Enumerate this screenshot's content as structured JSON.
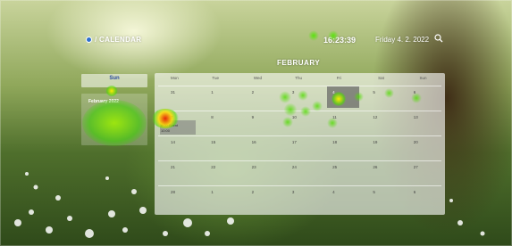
{
  "header": {
    "app_title": "/ CALENDAR",
    "time": "16:23:39",
    "date": "Friday 4. 2. 2022"
  },
  "left_panel": {
    "today_label": "Sun",
    "mini_calendar_title": "February 2022"
  },
  "calendar": {
    "month": "FEBRUARY",
    "weekdays": [
      "Mon",
      "Tue",
      "Wed",
      "Thu",
      "Fri",
      "Sat",
      "Sun"
    ],
    "days": [
      "31",
      "1",
      "2",
      "3",
      "4",
      "5",
      "6",
      "7",
      "8",
      "9",
      "10",
      "11",
      "12",
      "13",
      "14",
      "15",
      "16",
      "17",
      "18",
      "19",
      "20",
      "21",
      "22",
      "23",
      "24",
      "25",
      "26",
      "27",
      "28",
      "1",
      "2",
      "3",
      "4",
      "5",
      "6"
    ],
    "events": [
      {
        "day_index": 7,
        "line1": "8:00 Event",
        "line2": "10:00"
      },
      {
        "day_index": 4,
        "line1": "",
        "line2": ""
      }
    ]
  },
  "colors": {
    "accent": "#2e6fcf",
    "panel": "#ffffff"
  },
  "icons": [
    "calendar-logo-icon",
    "search-icon"
  ]
}
